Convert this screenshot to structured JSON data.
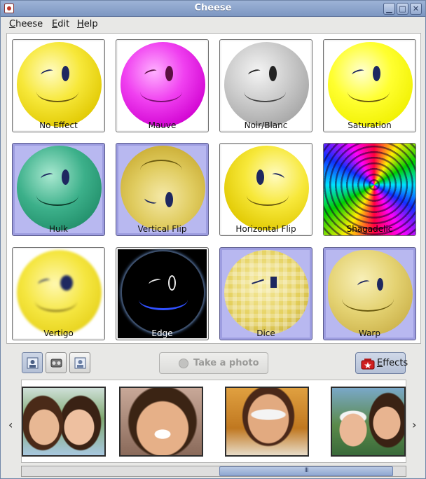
{
  "window": {
    "title": "Cheese"
  },
  "menu": {
    "items": [
      "Cheese",
      "Edit",
      "Help"
    ]
  },
  "effects": [
    {
      "label": "No Effect",
      "selected": false
    },
    {
      "label": "Mauve",
      "selected": false
    },
    {
      "label": "Noir/Blanc",
      "selected": false
    },
    {
      "label": "Saturation",
      "selected": false
    },
    {
      "label": "Hulk",
      "selected": true
    },
    {
      "label": "Vertical Flip",
      "selected": true
    },
    {
      "label": "Horizontal Flip",
      "selected": false
    },
    {
      "label": "Shagadelic",
      "selected": false
    },
    {
      "label": "Vertigo",
      "selected": false
    },
    {
      "label": "Edge",
      "selected": false
    },
    {
      "label": "Dice",
      "selected": true
    },
    {
      "label": "Warp",
      "selected": true
    }
  ],
  "toolbar": {
    "mode_icons": [
      "photo-mode-icon",
      "burst-mode-icon",
      "video-mode-icon"
    ],
    "take_photo_label": "Take a photo",
    "effects_label": "Effects"
  },
  "thumbnails": {
    "count": 4
  },
  "colors": {
    "titlebar": "#8aa2c9",
    "selected_tile": "#b8b8f0",
    "accent": "#7d97c2"
  }
}
